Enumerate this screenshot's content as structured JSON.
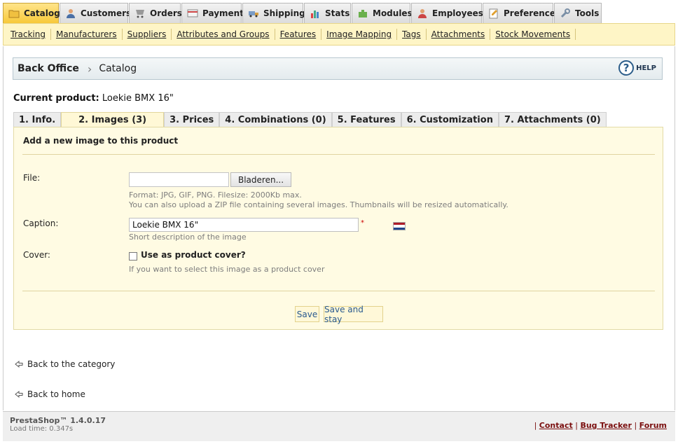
{
  "top_tabs": [
    {
      "label": "Catalog",
      "icon": "catalog-icon",
      "active": true
    },
    {
      "label": "Customers",
      "icon": "customers-icon"
    },
    {
      "label": "Orders",
      "icon": "orders-icon"
    },
    {
      "label": "Payment",
      "icon": "payment-icon"
    },
    {
      "label": "Shipping",
      "icon": "shipping-icon"
    },
    {
      "label": "Stats",
      "icon": "stats-icon"
    },
    {
      "label": "Modules",
      "icon": "modules-icon"
    },
    {
      "label": "Employees",
      "icon": "employees-icon"
    },
    {
      "label": "Preferences",
      "icon": "preferences-icon"
    },
    {
      "label": "Tools",
      "icon": "tools-icon"
    }
  ],
  "subnav": [
    "Tracking",
    "Manufacturers",
    "Suppliers",
    "Attributes and Groups",
    "Features",
    "Image Mapping",
    "Tags",
    "Attachments",
    "Stock Movements"
  ],
  "breadcrumb": {
    "home": "Back Office",
    "separator": "›",
    "current": "Catalog",
    "help": "HELP"
  },
  "current_product": {
    "label": "Current product:",
    "name": "Loekie BMX 16\""
  },
  "product_tabs": [
    "1. Info.",
    "2. Images (3)",
    "3. Prices",
    "4. Combinations (0)",
    "5. Features",
    "6. Customization",
    "7. Attachments (0)"
  ],
  "form": {
    "title": "Add a new image to this product",
    "file_label": "File:",
    "browse_button": "Bladeren...",
    "file_hint_1": "Format: JPG, GIF, PNG. Filesize: 2000Kb max.",
    "file_hint_2": "You can also upload a ZIP file containing several images. Thumbnails will be resized automatically.",
    "caption_label": "Caption:",
    "caption_value": "Loekie BMX 16\"",
    "required_marker": "*",
    "caption_hint": "Short description of the image",
    "cover_label": "Cover:",
    "cover_checkbox_label": "Use as product cover?",
    "cover_hint": "If you want to select this image as a product cover",
    "save": "Save",
    "save_and_stay": "Save and stay"
  },
  "links": {
    "back_category": "Back to the category",
    "back_home": "Back to home"
  },
  "footer": {
    "version": "PrestaShop™ 1.4.0.17",
    "load_time": "Load time: 0.347s",
    "contact": "Contact",
    "bug_tracker": "Bug Tracker",
    "forum": "Forum",
    "separator": "|"
  },
  "colors": {
    "active_tab": "#f7c93a",
    "subnav_bg": "#fef5c6",
    "panel_bg": "#fffbe3",
    "footer_link": "#7a0e0e"
  }
}
